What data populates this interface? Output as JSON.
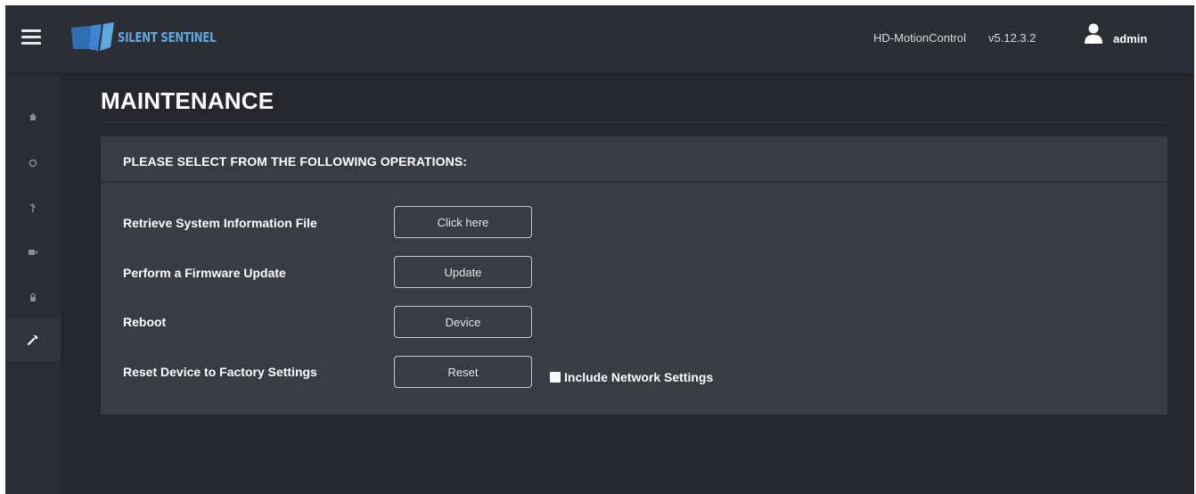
{
  "header": {
    "brand": "SILENT SENTINEL",
    "product": "HD-MotionControl",
    "version": "v5.12.3.2",
    "user": "admin",
    "brand_color": "#5ea8e0"
  },
  "sidebar": {
    "items": [
      {
        "name": "home",
        "icon": "home-icon"
      },
      {
        "name": "camera",
        "icon": "circle-icon"
      },
      {
        "name": "network",
        "icon": "network-icon"
      },
      {
        "name": "video",
        "icon": "video-camera-icon"
      },
      {
        "name": "security",
        "icon": "lock-icon"
      },
      {
        "name": "maintenance",
        "icon": "wrench-icon",
        "active": true
      }
    ]
  },
  "page": {
    "title": "MAINTENANCE"
  },
  "panel": {
    "heading": "PLEASE SELECT FROM THE FOLLOWING OPERATIONS:",
    "operations": [
      {
        "label": "Retrieve System Information File",
        "button": "Click here"
      },
      {
        "label": "Perform a Firmware Update",
        "button": "Update"
      },
      {
        "label": "Reboot",
        "button": "Device"
      },
      {
        "label": "Reset Device to Factory Settings",
        "button": "Reset"
      }
    ],
    "include_network_label": "Include Network Settings",
    "include_network_checked": false
  }
}
